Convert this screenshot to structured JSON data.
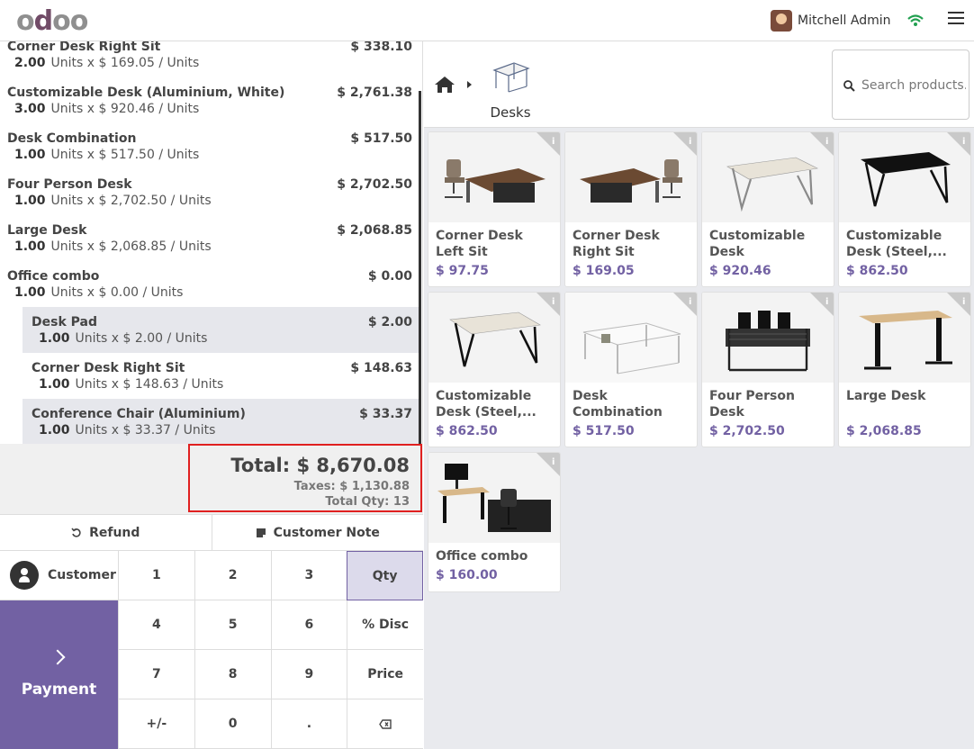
{
  "header": {
    "logo_o1": "o",
    "logo_d": "d",
    "logo_oo": "oo",
    "user_name": "Mitchell Admin"
  },
  "order": {
    "lines": [
      {
        "name": "Corner Desk Right Sit",
        "price": "$ 338.10",
        "qty": "2.00",
        "detail": "Units x $ 169.05 / Units"
      },
      {
        "name": "Customizable Desk (Aluminium, White)",
        "price": "$ 2,761.38",
        "qty": "3.00",
        "detail": "Units x $ 920.46 / Units"
      },
      {
        "name": "Desk Combination",
        "price": "$ 517.50",
        "qty": "1.00",
        "detail": "Units x $ 517.50 / Units"
      },
      {
        "name": "Four Person Desk",
        "price": "$ 2,702.50",
        "qty": "1.00",
        "detail": "Units x $ 2,702.50 / Units"
      },
      {
        "name": "Large Desk",
        "price": "$ 2,068.85",
        "qty": "1.00",
        "detail": "Units x $ 2,068.85 / Units"
      },
      {
        "name": "Office combo",
        "price": "$ 0.00",
        "qty": "1.00",
        "detail": "Units x $ 0.00 / Units"
      }
    ],
    "sub_lines": [
      {
        "name": "Desk Pad",
        "price": "$ 2.00",
        "qty": "1.00",
        "detail": "Units x $ 2.00 / Units"
      },
      {
        "name": "Corner Desk Right Sit",
        "price": "$ 148.63",
        "qty": "1.00",
        "detail": "Units x $ 148.63 / Units"
      },
      {
        "name": "Conference Chair (Aluminium)",
        "price": "$ 33.37",
        "qty": "1.00",
        "detail": "Units x $ 33.37 / Units"
      }
    ],
    "total": "Total: $ 8,670.08",
    "taxes": "Taxes: $ 1,130.88",
    "total_qty": "Total Qty: 13"
  },
  "actions": {
    "refund": "Refund",
    "customer_note": "Customer Note",
    "customer": "Customer",
    "payment": "Payment"
  },
  "numpad": [
    "1",
    "2",
    "3",
    "Qty",
    "4",
    "5",
    "6",
    "% Disc",
    "7",
    "8",
    "9",
    "Price",
    "+/-",
    "0",
    ".",
    ""
  ],
  "category": {
    "current": "Desks"
  },
  "search": {
    "placeholder": "Search products..."
  },
  "products": [
    {
      "name": "Corner Desk Left Sit",
      "price": "$ 97.75"
    },
    {
      "name": "Corner Desk Right Sit",
      "price": "$ 169.05"
    },
    {
      "name": "Customizable Desk (Aluminiu...",
      "price": "$ 920.46"
    },
    {
      "name": "Customizable Desk (Steel,...",
      "price": "$ 862.50"
    },
    {
      "name": "Customizable Desk (Steel,...",
      "price": "$ 862.50"
    },
    {
      "name": "Desk Combination",
      "price": "$ 517.50"
    },
    {
      "name": "Four Person Desk",
      "price": "$ 2,702.50"
    },
    {
      "name": "Large Desk",
      "price": "$ 2,068.85"
    },
    {
      "name": "Office combo",
      "price": "$ 160.00"
    }
  ],
  "colors": {
    "accent": "#7261a3",
    "highlight_row": "#e6e7ec",
    "total_border": "#e02020",
    "wifi": "#22a050"
  }
}
